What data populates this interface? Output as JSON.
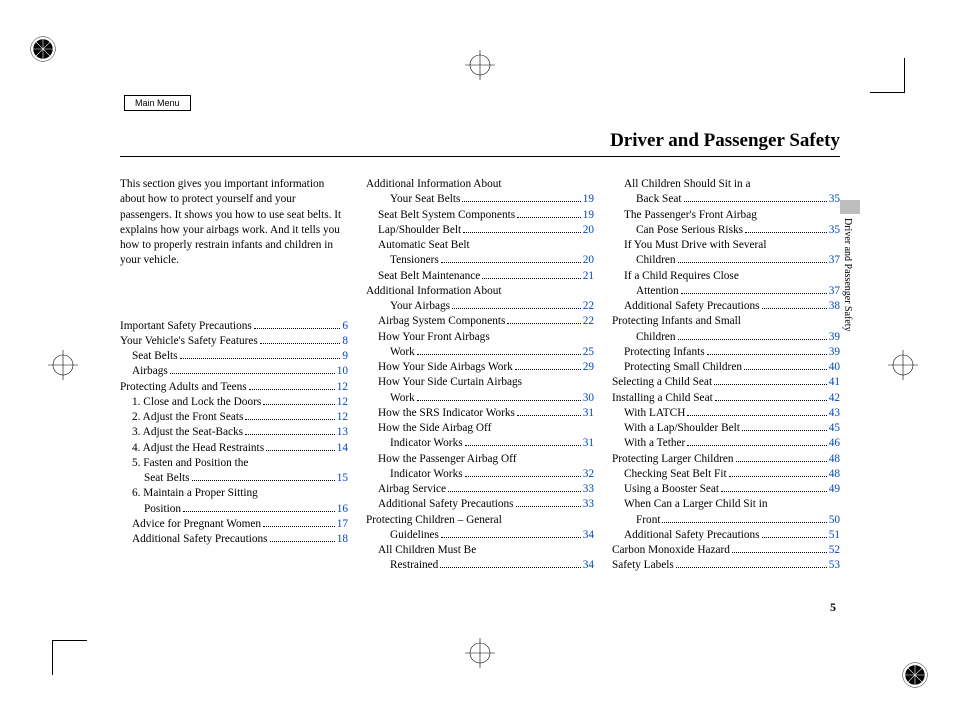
{
  "main_menu": "Main Menu",
  "title": "Driver and Passenger Safety",
  "side_label": "Driver and Passenger Safety",
  "page_number": "5",
  "intro": "This section gives you important information about how to protect yourself and your passengers. It shows you how to use seat belts. It explains how your airbags work. And it tells you how to properly restrain infants and children in your vehicle.",
  "col1": [
    {
      "t": "Important Safety Precautions",
      "p": "6",
      "i": 0
    },
    {
      "t": "Your Vehicle's Safety Features",
      "p": "8",
      "i": 0
    },
    {
      "t": "Seat Belts",
      "p": "9",
      "i": 1
    },
    {
      "t": "Airbags",
      "p": "10",
      "i": 1
    },
    {
      "t": "Protecting Adults and Teens",
      "p": "12",
      "i": 0
    },
    {
      "t": "1. Close and Lock the Doors",
      "p": "12",
      "i": 1
    },
    {
      "t": "2. Adjust the Front Seats",
      "p": "12",
      "i": 1
    },
    {
      "t": "3. Adjust the Seat-Backs",
      "p": "13",
      "i": 1
    },
    {
      "t": "4. Adjust the Head Restraints",
      "p": "14",
      "i": 1
    },
    {
      "t": "5. Fasten and Position the",
      "i": 1,
      "wrap": true
    },
    {
      "t": "Seat Belts",
      "p": "15",
      "i": 2
    },
    {
      "t": "6. Maintain a Proper Sitting",
      "i": 1,
      "wrap": true
    },
    {
      "t": "Position",
      "p": "16",
      "i": 2
    },
    {
      "t": "Advice for Pregnant Women",
      "p": "17",
      "i": 1
    },
    {
      "t": "Additional Safety Precautions",
      "p": "18",
      "i": 1
    }
  ],
  "col2": [
    {
      "t": "Additional Information About",
      "i": 0,
      "wrap": true
    },
    {
      "t": "Your Seat Belts",
      "p": "19",
      "i": 2
    },
    {
      "t": "Seat Belt System Components",
      "p": "19",
      "i": 1
    },
    {
      "t": "Lap/Shoulder Belt",
      "p": "20",
      "i": 1
    },
    {
      "t": "Automatic Seat Belt",
      "i": 1,
      "wrap": true
    },
    {
      "t": "Tensioners",
      "p": "20",
      "i": 2
    },
    {
      "t": "Seat Belt Maintenance",
      "p": "21",
      "i": 1
    },
    {
      "t": "Additional Information About",
      "i": 0,
      "wrap": true
    },
    {
      "t": "Your Airbags",
      "p": "22",
      "i": 2
    },
    {
      "t": "Airbag System Components",
      "p": "22",
      "i": 1
    },
    {
      "t": "How Your Front Airbags",
      "i": 1,
      "wrap": true
    },
    {
      "t": "Work",
      "p": "25",
      "i": 2
    },
    {
      "t": "How Your Side Airbags Work",
      "p": "29",
      "i": 1
    },
    {
      "t": "How Your Side Curtain Airbags",
      "i": 1,
      "wrap": true
    },
    {
      "t": "Work",
      "p": "30",
      "i": 2
    },
    {
      "t": "How the SRS Indicator Works",
      "p": "31",
      "i": 1
    },
    {
      "t": "How the Side Airbag Off",
      "i": 1,
      "wrap": true
    },
    {
      "t": "Indicator Works",
      "p": "31",
      "i": 2
    },
    {
      "t": "How the Passenger Airbag Off",
      "i": 1,
      "wrap": true
    },
    {
      "t": "Indicator Works",
      "p": "32",
      "i": 2
    },
    {
      "t": "Airbag Service",
      "p": "33",
      "i": 1
    },
    {
      "t": "Additional Safety Precautions",
      "p": "33",
      "i": 1
    },
    {
      "t": "Protecting Children – General",
      "i": 0,
      "wrap": true
    },
    {
      "t": "Guidelines",
      "p": "34",
      "i": 2
    },
    {
      "t": "All Children Must Be",
      "i": 1,
      "wrap": true
    },
    {
      "t": "Restrained",
      "p": "34",
      "i": 2
    }
  ],
  "col3": [
    {
      "t": "All Children Should Sit in a",
      "i": 1,
      "wrap": true
    },
    {
      "t": "Back Seat",
      "p": "35",
      "i": 2
    },
    {
      "t": "The Passenger's Front Airbag",
      "i": 1,
      "wrap": true
    },
    {
      "t": "Can Pose Serious Risks",
      "p": "35",
      "i": 2
    },
    {
      "t": "If You Must Drive with Several",
      "i": 1,
      "wrap": true
    },
    {
      "t": "Children",
      "p": "37",
      "i": 2
    },
    {
      "t": "If a Child Requires Close",
      "i": 1,
      "wrap": true
    },
    {
      "t": "Attention",
      "p": "37",
      "i": 2
    },
    {
      "t": "Additional Safety Precautions",
      "p": "38",
      "i": 1
    },
    {
      "t": "Protecting Infants and Small",
      "i": 0,
      "wrap": true
    },
    {
      "t": "Children",
      "p": "39",
      "i": 2
    },
    {
      "t": "Protecting Infants",
      "p": "39",
      "i": 1
    },
    {
      "t": "Protecting Small Children",
      "p": "40",
      "i": 1
    },
    {
      "t": "Selecting a Child Seat",
      "p": "41",
      "i": 0
    },
    {
      "t": "Installing a Child Seat",
      "p": "42",
      "i": 0
    },
    {
      "t": "With LATCH",
      "p": "43",
      "i": 1
    },
    {
      "t": "With a Lap/Shoulder Belt",
      "p": "45",
      "i": 1
    },
    {
      "t": "With a Tether",
      "p": "46",
      "i": 1
    },
    {
      "t": "Protecting Larger Children",
      "p": "48",
      "i": 0
    },
    {
      "t": "Checking Seat Belt Fit",
      "p": "48",
      "i": 1
    },
    {
      "t": "Using a Booster Seat",
      "p": "49",
      "i": 1
    },
    {
      "t": "When Can a Larger Child Sit in",
      "i": 1,
      "wrap": true
    },
    {
      "t": "Front",
      "p": "50",
      "i": 2
    },
    {
      "t": "Additional Safety Precautions",
      "p": "51",
      "i": 1
    },
    {
      "t": "Carbon Monoxide Hazard",
      "p": "52",
      "i": 0
    },
    {
      "t": "Safety Labels",
      "p": "53",
      "i": 0
    }
  ]
}
